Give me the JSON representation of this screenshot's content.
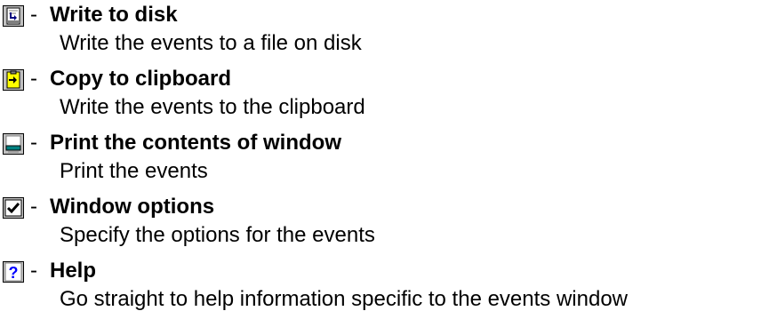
{
  "items": [
    {
      "icon": "write-to-disk-icon",
      "separator": "-",
      "title": "Write to disk",
      "description": "Write the events to a file on disk"
    },
    {
      "icon": "copy-to-clipboard-icon",
      "separator": "-",
      "title": "Copy to clipboard",
      "description": "Write the events to the clipboard"
    },
    {
      "icon": "print-icon",
      "separator": "-",
      "title": "Print the contents of window",
      "description": "Print the events"
    },
    {
      "icon": "window-options-check-icon",
      "separator": "-",
      "title": "Window options",
      "description": "Specify the options for the events"
    },
    {
      "icon": "help-question-icon",
      "separator": "-",
      "title": "Help",
      "description": "Go straight to help information specific to the events window"
    }
  ]
}
